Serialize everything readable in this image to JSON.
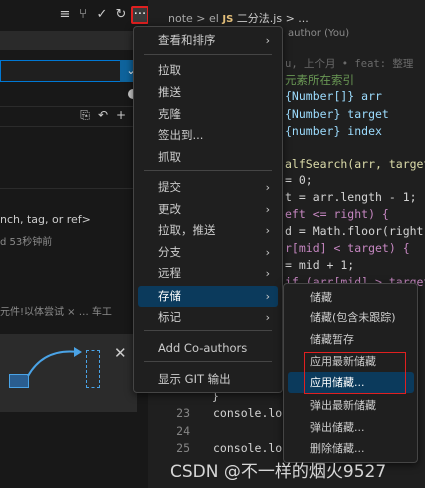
{
  "left_panel": {
    "branch_prompt": "nch, tag, or ref>",
    "relative_time": "d 53秒钟前",
    "garbled_text": "元件!以体尝试 ×  … 车工",
    "tip_close_glyph": "✕"
  },
  "toolbar": {
    "more_glyph": "···"
  },
  "breadcrumb": {
    "part1": "note",
    "sep": ">",
    "part2": "el",
    "js_badge": "JS",
    "file": "二分法.js",
    "tail": "> ..."
  },
  "blame": {
    "author": "author (You)",
    "inline": "u, 上个月 • feat: 整理"
  },
  "code": [
    {
      "text": "元素所在索引",
      "color": "comment"
    },
    {
      "text": "{Number[]} arr",
      "color": "blue"
    },
    {
      "text": "{Number} target",
      "color": "blue"
    },
    {
      "text": "{number} index",
      "color": "blue"
    },
    {
      "text": "",
      "color": "white"
    },
    {
      "text": "alfSearch(arr, target",
      "color": "yellow"
    },
    {
      "text": "= 0;",
      "color": "white"
    },
    {
      "text": "t = arr.length - 1;",
      "color": "white"
    },
    {
      "text": "eft <= right) {",
      "color": "purple"
    },
    {
      "text": "d = Math.floor(right",
      "color": "white"
    },
    {
      "text": "r[mid] < target) {",
      "color": "purple"
    },
    {
      "text": "= mid + 1;",
      "color": "white"
    },
    {
      "text": "if (arr[mid] > target",
      "color": "purple"
    }
  ],
  "bottom_code": [
    {
      "line": "23",
      "text": "console.lo",
      "color": "white"
    },
    {
      "line": "24",
      "text": "",
      "color": "white"
    },
    {
      "line": "25",
      "text": "console.lo",
      "color": "white"
    }
  ],
  "bottom_brace": "}",
  "main_menu": {
    "items": [
      {
        "label": "查看和排序",
        "submenu": true,
        "active": false
      },
      {
        "label": "拉取",
        "submenu": false,
        "active": false
      },
      {
        "label": "推送",
        "submenu": false,
        "active": false
      },
      {
        "label": "克隆",
        "submenu": false,
        "active": false
      },
      {
        "label": "签出到...",
        "submenu": false,
        "active": false
      },
      {
        "label": "抓取",
        "submenu": false,
        "active": false
      },
      {
        "label": "提交",
        "submenu": true,
        "active": false
      },
      {
        "label": "更改",
        "submenu": true,
        "active": false
      },
      {
        "label": "拉取，推送",
        "submenu": true,
        "active": false
      },
      {
        "label": "分支",
        "submenu": true,
        "active": false
      },
      {
        "label": "远程",
        "submenu": true,
        "active": false
      },
      {
        "label": "存储",
        "submenu": true,
        "active": true
      },
      {
        "label": "标记",
        "submenu": true,
        "active": false
      },
      {
        "label": "Add Co-authors",
        "submenu": false,
        "active": false
      },
      {
        "label": "显示 GIT 输出",
        "submenu": false,
        "active": false
      }
    ],
    "chevron": "›"
  },
  "stash_submenu": {
    "items": [
      {
        "label": "储藏",
        "highlighted": false
      },
      {
        "label": "储藏(包含未跟踪)",
        "highlighted": false
      },
      {
        "label": "储藏暂存",
        "highlighted": false
      },
      {
        "label": "应用最新储藏",
        "highlighted": false
      },
      {
        "label": "应用储藏...",
        "highlighted": true
      },
      {
        "label": "弹出最新储藏",
        "highlighted": false
      },
      {
        "label": "弹出储藏...",
        "highlighted": false
      },
      {
        "label": "删除储藏...",
        "highlighted": false
      }
    ]
  },
  "watermark": "CSDN @不一样的烟火9527",
  "colors": {
    "menu_active": "#0b3a5c",
    "annotation_red": "#e02020",
    "accent_blue": "#0078d4"
  }
}
